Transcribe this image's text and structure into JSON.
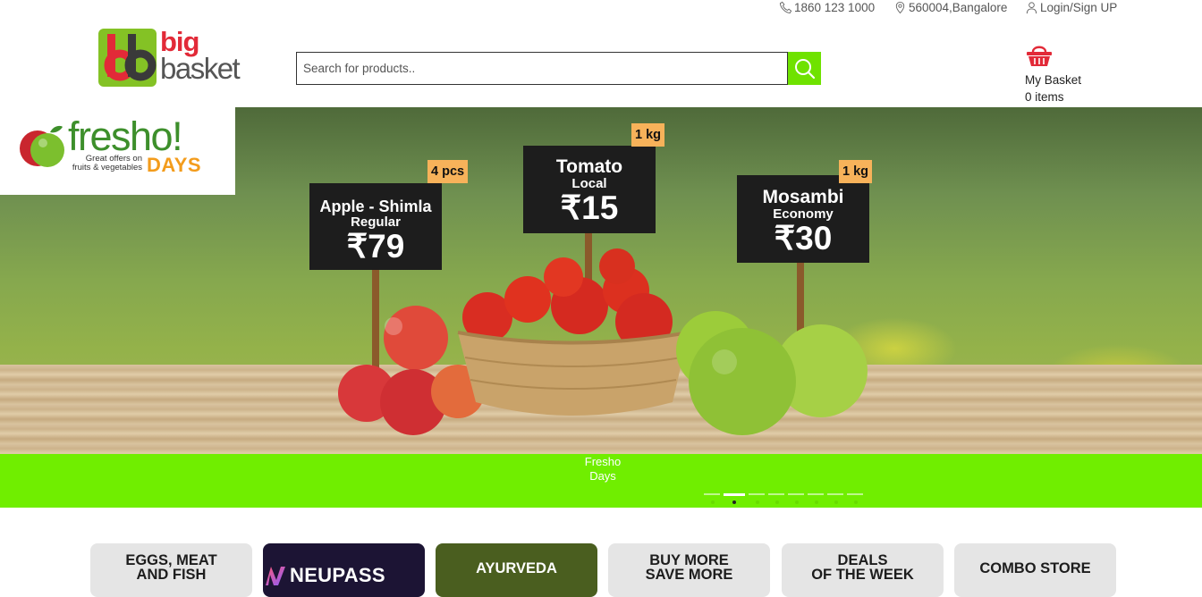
{
  "header": {
    "phone": "1860 123 1000",
    "location": "560004,Bangalore",
    "login": "Login/Sign UP",
    "logo_line1": "big",
    "logo_line2": "basket",
    "search_placeholder": "Search for products..",
    "basket_label": "My Basket",
    "basket_count": "0 items"
  },
  "banner": {
    "brand": "fresho!",
    "brand_sub": "Great offers on fruits & vegetables",
    "brand_days": "DAYS",
    "products": [
      {
        "name": "Apple - Shimla",
        "variant": "Regular",
        "price": "₹79",
        "qty": "4 pcs"
      },
      {
        "name": "Tomato",
        "variant": "Local",
        "price": "₹15",
        "qty": "1 kg"
      },
      {
        "name": "Mosambi",
        "variant": "Economy",
        "price": "₹30",
        "qty": "1 kg"
      }
    ],
    "caption_line1": "Fresho",
    "caption_line2": "Days",
    "slide_count": 8,
    "active_slide": 2
  },
  "categories": [
    {
      "line1": "EGGS, MEAT",
      "line2": "AND FISH"
    },
    {
      "line1": "NEUPASS"
    },
    {
      "line1": "AYURVEDA"
    },
    {
      "line1": "BUY MORE",
      "line2": "SAVE MORE"
    },
    {
      "line1": "DEALS",
      "line2": "OF THE WEEK"
    },
    {
      "line1": "COMBO STORE"
    }
  ],
  "colors": {
    "brand_green": "#84c225",
    "brand_red": "#e22a38",
    "accent_green": "#70ee00",
    "search_button": "#6fe200"
  }
}
